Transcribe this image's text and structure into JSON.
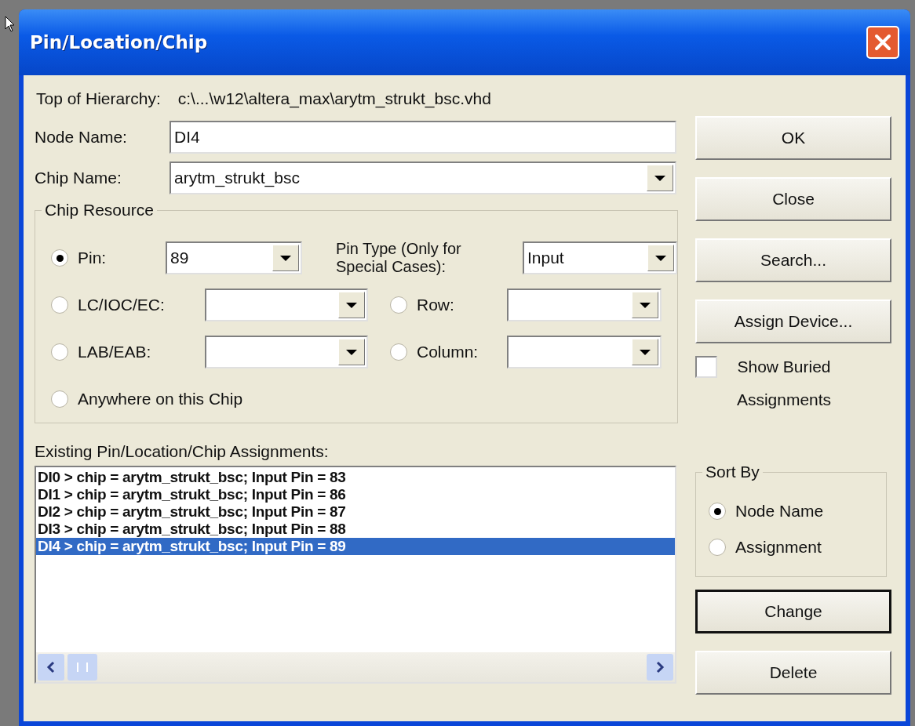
{
  "window": {
    "title": "Pin/Location/Chip"
  },
  "top_of_hierarchy": {
    "label": "Top of Hierarchy:",
    "value": "c:\\...\\w12\\altera_max\\arytm_strukt_bsc.vhd"
  },
  "node_name": {
    "label": "Node Name:",
    "value": "DI4"
  },
  "chip_name": {
    "label": "Chip Name:",
    "value": "arytm_strukt_bsc"
  },
  "chip_resource": {
    "title": "Chip Resource",
    "rows": [
      [
        {
          "kind": "radio_combo",
          "label": "Pin:",
          "selected": true,
          "value": "89"
        },
        {
          "kind": "text_combo",
          "label": "Pin Type (Only for Special Cases):",
          "value": "Input"
        }
      ],
      [
        {
          "kind": "radio_combo",
          "label": "LC/IOC/EC:",
          "selected": false
        },
        {
          "kind": "radio_combo",
          "label": "Row:",
          "selected": false
        }
      ],
      [
        {
          "kind": "radio_combo",
          "label": "LAB/EAB:",
          "selected": false
        },
        {
          "kind": "radio_combo",
          "label": "Column:",
          "selected": false
        }
      ],
      [
        {
          "kind": "radio",
          "label": "Anywhere on this Chip",
          "selected": false
        }
      ]
    ]
  },
  "assignments": {
    "label": "Existing Pin/Location/Chip Assignments:",
    "items": [
      {
        "text": "DI0 > chip = arytm_strukt_bsc; Input Pin = 83",
        "selected": false
      },
      {
        "text": "DI1 > chip = arytm_strukt_bsc; Input Pin = 86",
        "selected": false
      },
      {
        "text": "DI2 > chip = arytm_strukt_bsc; Input Pin = 87",
        "selected": false
      },
      {
        "text": "DI3 > chip = arytm_strukt_bsc; Input Pin = 88",
        "selected": false
      },
      {
        "text": "DI4 > chip = arytm_strukt_bsc; Input Pin = 89",
        "selected": true
      }
    ]
  },
  "buttons": [
    {
      "label": "OK",
      "default": false
    },
    {
      "label": "Close",
      "default": false
    },
    {
      "label": "Search...",
      "default": false
    },
    {
      "label": "Assign Device...",
      "default": false
    }
  ],
  "show_buried": {
    "label": "Show Buried Assignments",
    "checked": false
  },
  "sort_by": {
    "title": "Sort By",
    "options": [
      {
        "label": "Node Name",
        "selected": true
      },
      {
        "label": "Assignment",
        "selected": false
      }
    ]
  },
  "bottom_buttons": [
    {
      "label": "Change",
      "default": true
    },
    {
      "label": "Delete",
      "default": false
    }
  ]
}
